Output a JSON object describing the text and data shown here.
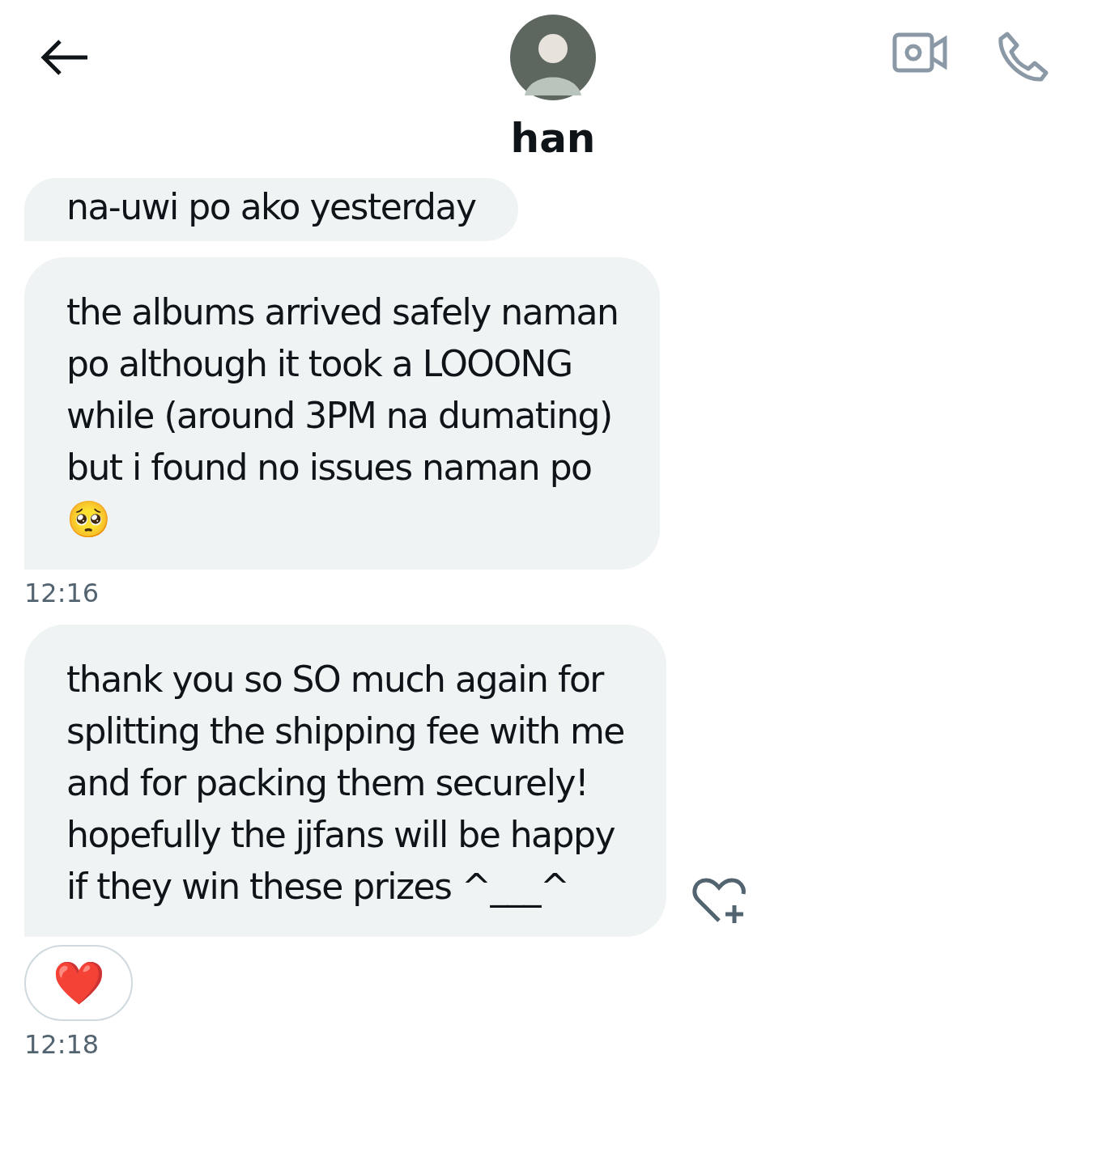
{
  "header": {
    "name": "han"
  },
  "messages": [
    {
      "kind": "text",
      "lines": [
        "na-uwi po ako yesterday"
      ]
    },
    {
      "kind": "text",
      "lines": [
        "the albums arrived safely naman",
        "po although it took a LOOONG",
        "while (around 3PM na dumating)",
        "but i found no issues naman po",
        "🥺"
      ],
      "time": "12:16"
    },
    {
      "kind": "text",
      "lines": [
        "thank you so SO much again for",
        "splitting the shipping fee with me",
        "and for packing them securely!",
        "hopefully the jjfans will be happy",
        "if they win these prizes ^___^"
      ],
      "reaction": "❤️",
      "time": "12:18",
      "react_button": true
    }
  ]
}
